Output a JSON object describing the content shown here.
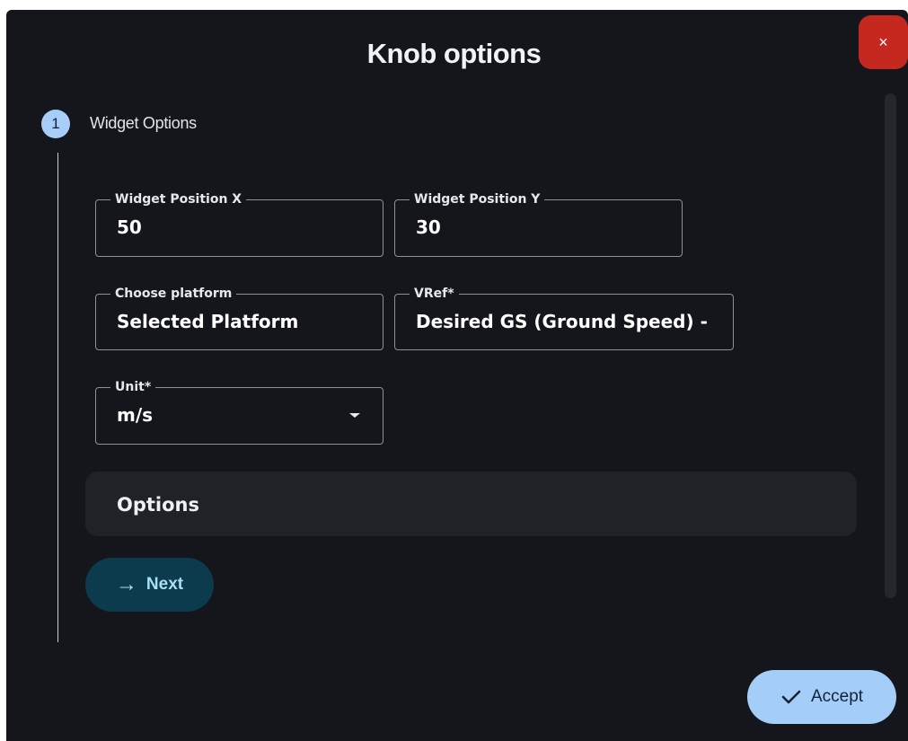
{
  "dialog": {
    "title": "Knob options",
    "close_icon": "close-icon",
    "close_symbol": "×"
  },
  "stepper": {
    "step_number": "1",
    "step_label": "Widget Options"
  },
  "fields": {
    "position_x": {
      "label": "Widget Position X",
      "value": "50"
    },
    "position_y": {
      "label": "Widget Position Y",
      "value": "30"
    },
    "platform": {
      "label": "Choose platform",
      "value": "Selected Platform"
    },
    "vref": {
      "label": "VRef*",
      "value": "Desired GS (Ground Speed) -"
    },
    "unit": {
      "label": "Unit*",
      "value": "m/s",
      "icon": "chevron-down-icon"
    }
  },
  "options_panel": {
    "label": "Options"
  },
  "buttons": {
    "next_label": "Next",
    "next_icon": "arrow-right-icon",
    "next_symbol": "→",
    "accept_label": "Accept",
    "accept_icon": "check-icon"
  },
  "colors": {
    "background": "#14161b",
    "close_button": "#c5281f",
    "step_circle": "#a7cdf8",
    "next_button": "#0c3b4e",
    "accept_button": "#a4cef8"
  }
}
